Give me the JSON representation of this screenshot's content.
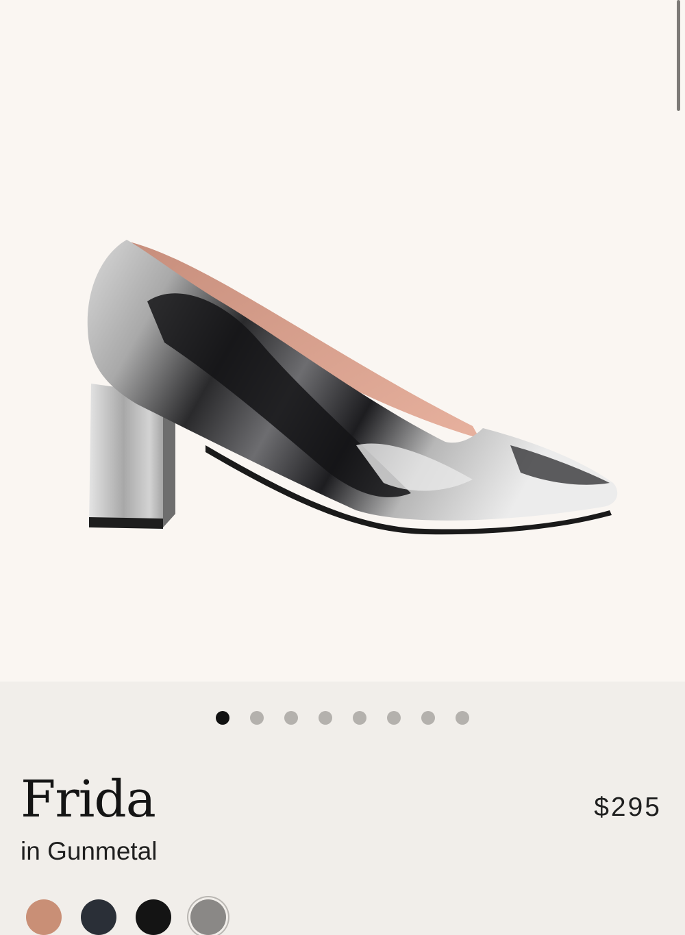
{
  "product": {
    "name": "Frida",
    "color_line": "in Gunmetal",
    "price": "$295"
  },
  "gallery": {
    "image_alt": "silver metallic block-heel pump",
    "total_slides": 8,
    "active_index": 0
  },
  "swatches": [
    {
      "name": "blush",
      "color": "#c98f76"
    },
    {
      "name": "navy",
      "color": "#2a2f37"
    },
    {
      "name": "black",
      "color": "#141414"
    },
    {
      "name": "gunmetal",
      "color": "#8a8886",
      "selected": true
    }
  ],
  "colors": {
    "hero_bg": "#faf6f2",
    "page_bg": "#f1eeea",
    "dot_active": "#111111",
    "dot_inactive": "#b4b1ad"
  }
}
